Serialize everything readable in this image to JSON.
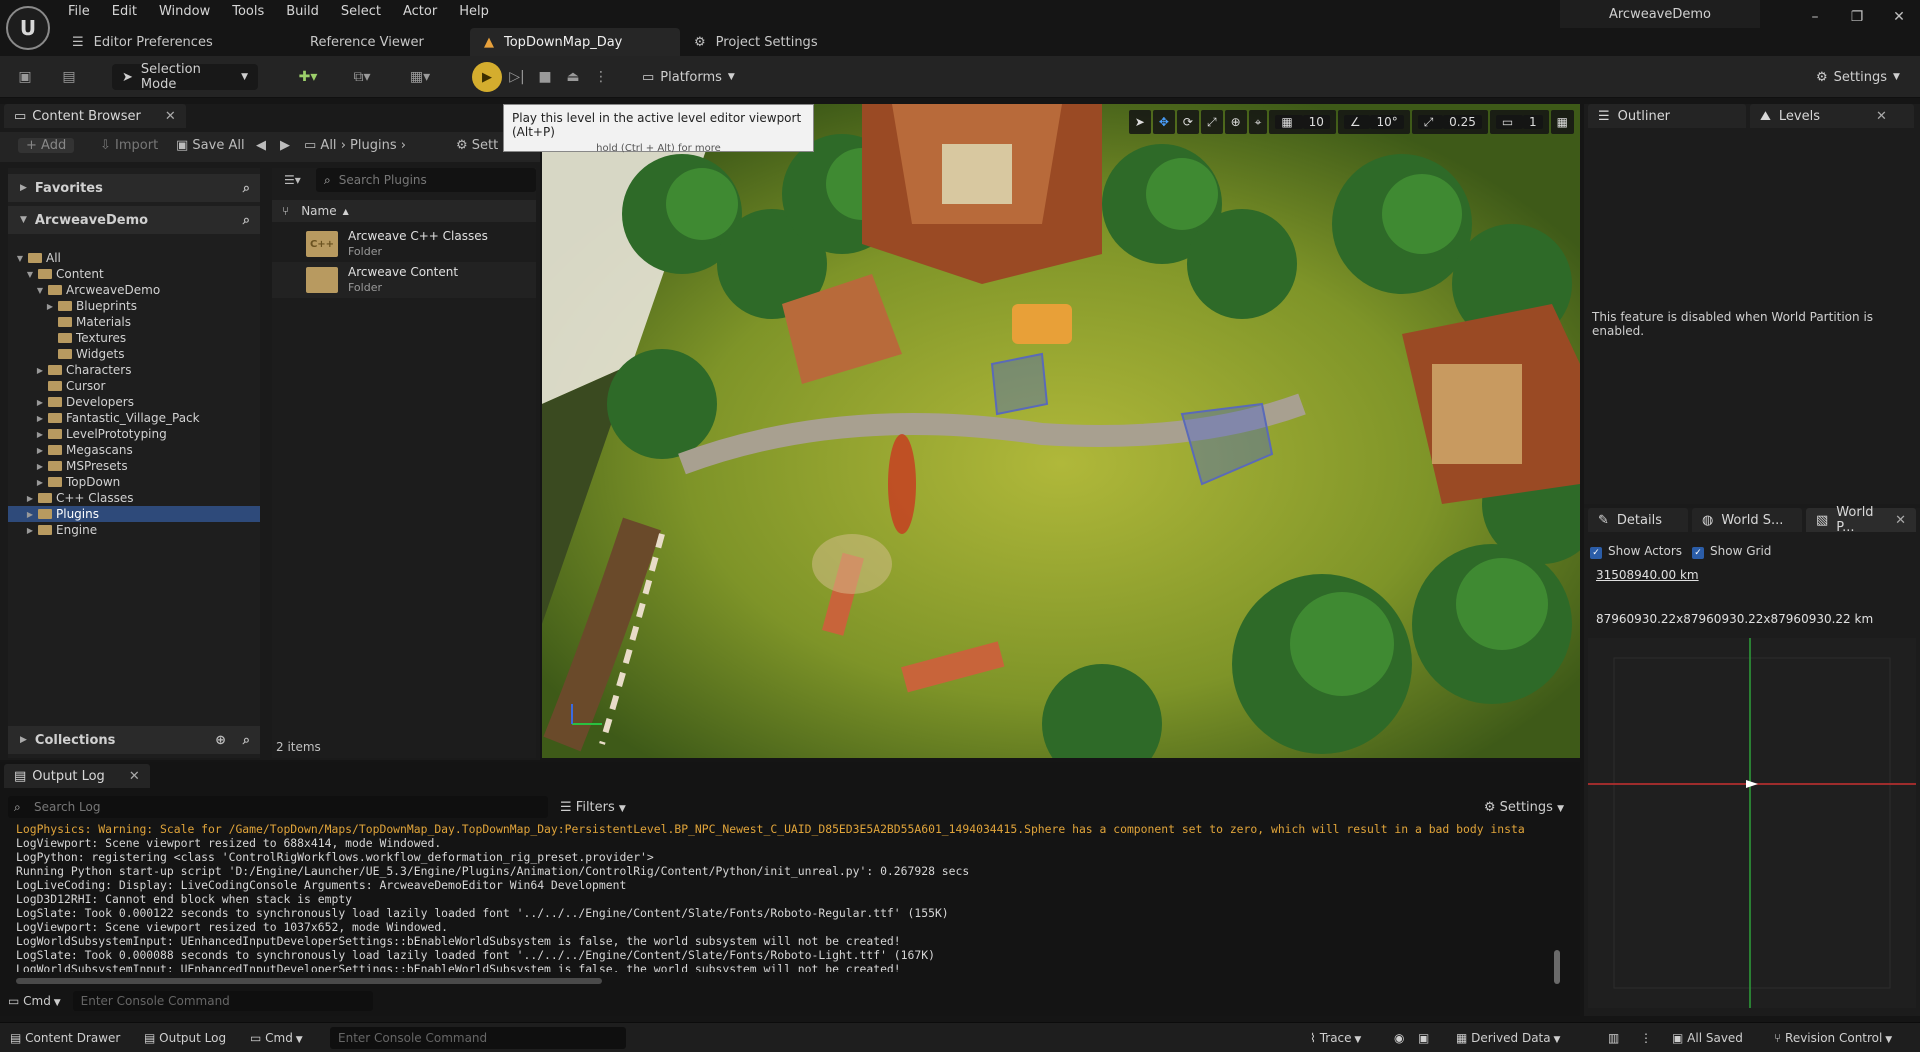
{
  "menu": [
    "File",
    "Edit",
    "Window",
    "Tools",
    "Build",
    "Select",
    "Actor",
    "Help"
  ],
  "project_name": "ArcweaveDemo",
  "doc_tabs": [
    {
      "label": "Editor Preferences"
    },
    {
      "label": "Reference Viewer"
    },
    {
      "label": "TopDownMap_Day"
    },
    {
      "label": "Project Settings"
    }
  ],
  "toolbar": {
    "selection_mode": "Selection Mode",
    "platforms": "Platforms",
    "settings": "Settings"
  },
  "tooltip": {
    "line1": "Play this level in the active level editor viewport (Alt+P)",
    "line2": "hold (Ctrl + Alt) for more"
  },
  "content_browser": {
    "tab": "Content Browser",
    "add": "Add",
    "import": "Import",
    "save_all": "Save All",
    "path": [
      "All",
      "Plugins"
    ],
    "settings_trunc": "Sett",
    "favorites": "Favorites",
    "project": "ArcweaveDemo",
    "tree": [
      {
        "label": "All",
        "indent": 0,
        "arrow": "▼"
      },
      {
        "label": "Content",
        "indent": 1,
        "arrow": "▼"
      },
      {
        "label": "ArcweaveDemo",
        "indent": 2,
        "arrow": "▼"
      },
      {
        "label": "Blueprints",
        "indent": 3,
        "arrow": "▶"
      },
      {
        "label": "Materials",
        "indent": 3,
        "arrow": ""
      },
      {
        "label": "Textures",
        "indent": 3,
        "arrow": ""
      },
      {
        "label": "Widgets",
        "indent": 3,
        "arrow": ""
      },
      {
        "label": "Characters",
        "indent": 2,
        "arrow": "▶"
      },
      {
        "label": "Cursor",
        "indent": 2,
        "arrow": ""
      },
      {
        "label": "Developers",
        "indent": 2,
        "arrow": "▶"
      },
      {
        "label": "Fantastic_Village_Pack",
        "indent": 2,
        "arrow": "▶"
      },
      {
        "label": "LevelPrototyping",
        "indent": 2,
        "arrow": "▶"
      },
      {
        "label": "Megascans",
        "indent": 2,
        "arrow": "▶"
      },
      {
        "label": "MSPresets",
        "indent": 2,
        "arrow": "▶"
      },
      {
        "label": "TopDown",
        "indent": 2,
        "arrow": "▶"
      },
      {
        "label": "C++ Classes",
        "indent": 1,
        "arrow": "▶"
      },
      {
        "label": "Plugins",
        "indent": 1,
        "arrow": "▶",
        "selected": true
      },
      {
        "label": "Engine",
        "indent": 1,
        "arrow": "▶"
      }
    ],
    "collections": "Collections",
    "search_placeholder": "Search Plugins",
    "col_name": "Name",
    "assets": [
      {
        "name": "Arcweave C++ Classes",
        "type": "Folder",
        "badge": "C++"
      },
      {
        "name": "Arcweave Content",
        "type": "Folder",
        "badge": ""
      }
    ],
    "item_count": "2 items"
  },
  "viewport": {
    "grid_snap": "10",
    "rot_snap": "10°",
    "scale_snap": "0.25",
    "cam_speed": "1"
  },
  "outliner": {
    "tab": "Outliner",
    "levels_tab": "Levels",
    "message": "This feature is disabled when World Partition is enabled."
  },
  "details": {
    "tab_details": "Details",
    "tab_world_s": "World S...",
    "tab_world_p": "World P...",
    "show_actors": "Show Actors",
    "show_grid": "Show Grid",
    "scale": "31508940.00 km",
    "size": "87960930.22x87960930.22x87960930.22 km"
  },
  "output_log": {
    "tab": "Output Log",
    "search_placeholder": "Search Log",
    "filters": "Filters",
    "settings": "Settings",
    "lines": [
      {
        "text": "LogPhysics: Warning: Scale for /Game/TopDown/Maps/TopDownMap_Day.TopDownMap_Day:PersistentLevel.BP_NPC_Newest_C_UAID_D85ED3E5A2BD55A601_1494034415.Sphere has a component set to zero, which will result in a bad body insta",
        "warn": true
      },
      {
        "text": "LogViewport: Scene viewport resized to 688x414, mode Windowed.",
        "warn": false
      },
      {
        "text": "LogPython: registering <class 'ControlRigWorkflows.workflow_deformation_rig_preset.provider'>",
        "warn": false
      },
      {
        "text": "Running Python start-up script 'D:/Engine/Launcher/UE_5.3/Engine/Plugins/Animation/ControlRig/Content/Python/init_unreal.py': 0.267928 secs",
        "warn": false
      },
      {
        "text": "LogLiveCoding: Display: LiveCodingConsole Arguments: ArcweaveDemoEditor Win64 Development",
        "warn": false
      },
      {
        "text": "LogD3D12RHI: Cannot end block when stack is empty",
        "warn": false
      },
      {
        "text": "LogSlate: Took 0.000122 seconds to synchronously load lazily loaded font '../../../Engine/Content/Slate/Fonts/Roboto-Regular.ttf' (155K)",
        "warn": false
      },
      {
        "text": "LogViewport: Scene viewport resized to 1037x652, mode Windowed.",
        "warn": false
      },
      {
        "text": "LogWorldSubsystemInput: UEnhancedInputDeveloperSettings::bEnableWorldSubsystem is false, the world subsystem will not be created!",
        "warn": false
      },
      {
        "text": "LogSlate: Took 0.000088 seconds to synchronously load lazily loaded font '../../../Engine/Content/Slate/Fonts/Roboto-Light.ttf' (167K)",
        "warn": false
      },
      {
        "text": "LogWorldSubsystemInput: UEnhancedInputDeveloperSettings::bEnableWorldSubsystem is false, the world subsystem will not be created!",
        "warn": false
      }
    ],
    "cmd": "Cmd",
    "cmd_placeholder": "Enter Console Command"
  },
  "status_bar": {
    "content_drawer": "Content Drawer",
    "output_log": "Output Log",
    "cmd": "Cmd",
    "cmd_placeholder": "Enter Console Command",
    "trace": "Trace",
    "derived_data": "Derived Data",
    "all_saved": "All Saved",
    "revision_control": "Revision Control"
  }
}
